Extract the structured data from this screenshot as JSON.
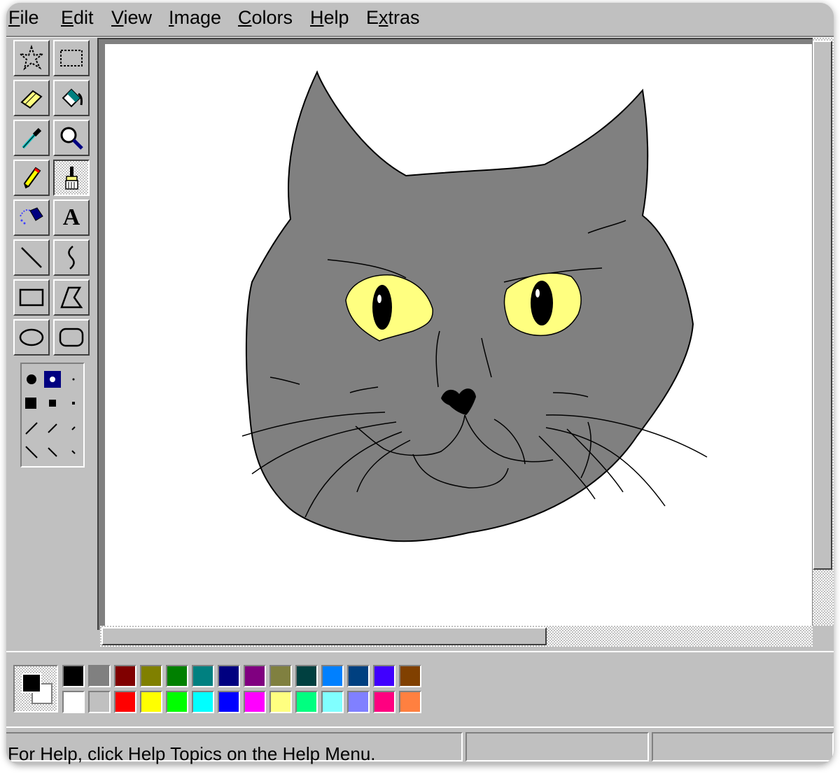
{
  "menu": {
    "file": "File",
    "edit": "Edit",
    "view": "View",
    "image": "Image",
    "colors": "Colors",
    "help": "Help",
    "extras": "Extras"
  },
  "tools": [
    {
      "name": "free-form-select",
      "icon": "free-form-select-icon"
    },
    {
      "name": "select",
      "icon": "rectangle-select-icon"
    },
    {
      "name": "eraser",
      "icon": "eraser-icon"
    },
    {
      "name": "fill-with-color",
      "icon": "paint-bucket-icon"
    },
    {
      "name": "pick-color",
      "icon": "eyedropper-icon"
    },
    {
      "name": "magnifier",
      "icon": "magnifier-icon"
    },
    {
      "name": "pencil",
      "icon": "pencil-icon"
    },
    {
      "name": "brush",
      "icon": "brush-icon",
      "selected": true
    },
    {
      "name": "airbrush",
      "icon": "airbrush-icon"
    },
    {
      "name": "text",
      "icon": "text-icon"
    },
    {
      "name": "line",
      "icon": "line-icon"
    },
    {
      "name": "curve",
      "icon": "curve-icon"
    },
    {
      "name": "rectangle",
      "icon": "rectangle-icon"
    },
    {
      "name": "polygon",
      "icon": "polygon-icon"
    },
    {
      "name": "ellipse",
      "icon": "ellipse-icon"
    },
    {
      "name": "rounded-rectangle",
      "icon": "rounded-rectangle-icon"
    }
  ],
  "text_tool_glyph": "A",
  "colors": {
    "foreground": "#000000",
    "background": "#ffffff",
    "palette_top": [
      "#000000",
      "#808080",
      "#800000",
      "#808000",
      "#008000",
      "#008080",
      "#000080",
      "#800080",
      "#808040",
      "#004040",
      "#0080ff",
      "#004080",
      "#4000ff",
      "#804000"
    ],
    "palette_bottom": [
      "#ffffff",
      "#c0c0c0",
      "#ff0000",
      "#ffff00",
      "#00ff00",
      "#00ffff",
      "#0000ff",
      "#ff00ff",
      "#ffff80",
      "#00ff80",
      "#80ffff",
      "#8080ff",
      "#ff0080",
      "#ff8040"
    ]
  },
  "canvas": {
    "subject": "cat-face-drawing",
    "fill_color": "#808080",
    "eye_color": "#ffff80"
  },
  "status": {
    "message": "For Help, click Help Topics on the Help Menu.",
    "coords": "",
    "size": ""
  }
}
